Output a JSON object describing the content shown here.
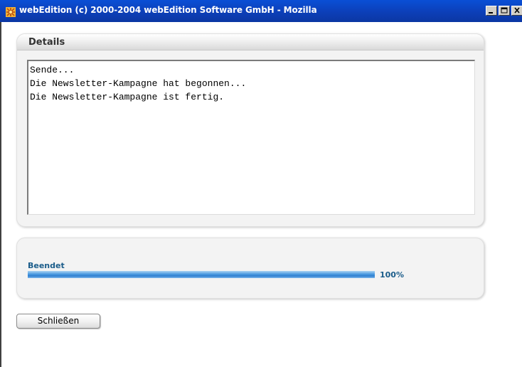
{
  "window": {
    "title": "webEdition (c) 2000-2004 webEdition Software GmbH - Mozilla",
    "app_icon": "webedition-logo-icon",
    "controls": [
      "minimize-icon",
      "maximize-icon",
      "close-icon"
    ]
  },
  "details": {
    "title": "Details",
    "log_lines": [
      "Sende...",
      "Die Newsletter-Kampagne hat begonnen...",
      "Die Newsletter-Kampagne ist fertig."
    ]
  },
  "progress": {
    "label": "Beendet",
    "percent_text": "100%",
    "value": 1.0
  },
  "buttons": {
    "close_label": "Schließen"
  },
  "colors": {
    "titlebar": "#0c3fb8",
    "progress_fill": "#2f7fcf",
    "progress_text": "#1a5c8a",
    "panel_bg": "#f3f3f3"
  }
}
